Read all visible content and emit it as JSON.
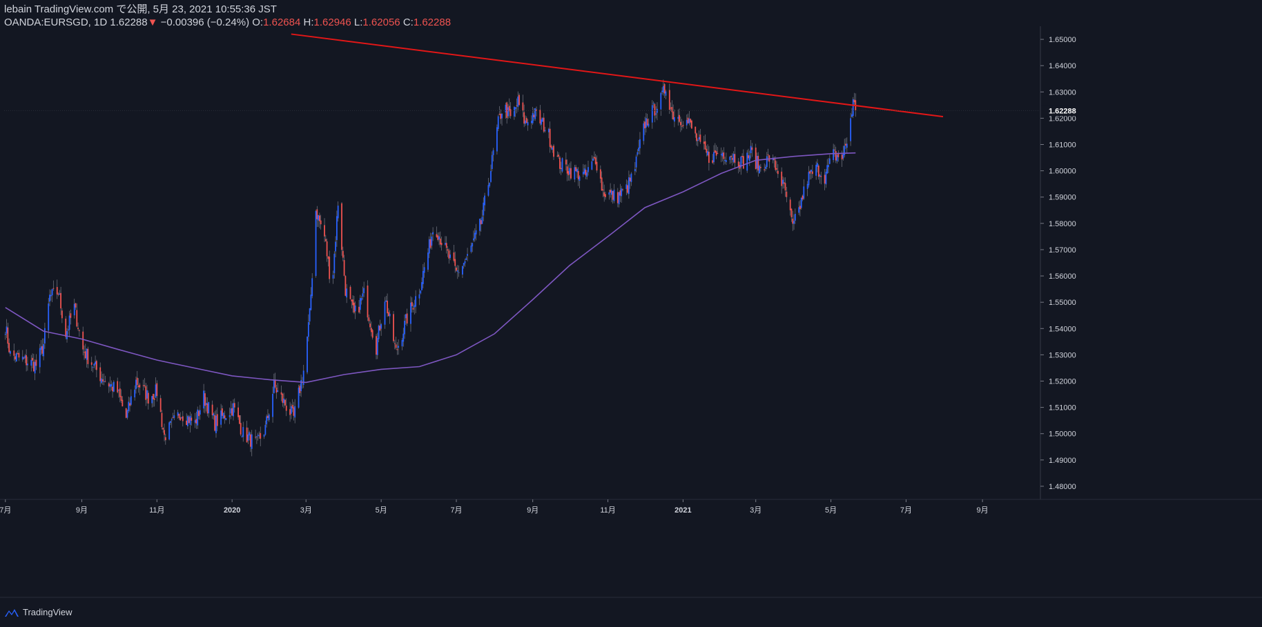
{
  "header": {
    "line1": "lebain TradingView.com で公開, 5月 23, 2021 10:55:36 JST",
    "symbol": "OANDA:EURSGD, 1D",
    "last": "1.62288",
    "down_arrow": "▼",
    "change": "−0.00396 (−0.24%)",
    "o_label": "O:",
    "o_value": "1.62684",
    "h_label": "H:",
    "h_value": "1.62946",
    "l_label": "L:",
    "l_value": "1.62056",
    "c_label": "C:",
    "c_value": "1.62288"
  },
  "footer": {
    "brand": "TradingView",
    "icon": "tradingview-logo-icon"
  },
  "colors": {
    "background": "#131722",
    "up": "#2962ff",
    "down": "#ef5350",
    "ma": "#7e57c2",
    "trendline": "#e31717",
    "text": "#d1d4dc"
  },
  "chart_data": {
    "type": "candlestick",
    "ylim": [
      1.475,
      1.655
    ],
    "y_ticks": [
      "1.65000",
      "1.64000",
      "1.63000",
      "1.62000",
      "1.61000",
      "1.60000",
      "1.59000",
      "1.58000",
      "1.57000",
      "1.56000",
      "1.55000",
      "1.54000",
      "1.53000",
      "1.52000",
      "1.51000",
      "1.50000",
      "1.49000",
      "1.48000"
    ],
    "x_ticks": [
      "7月",
      "9月",
      "11月",
      "2020",
      "3月",
      "5月",
      "7月",
      "9月",
      "11月",
      "2021",
      "3月",
      "5月",
      "7月",
      "9月"
    ],
    "last_price_label": "1.62288",
    "close_path": [
      [
        "2019-07-01",
        1.541
      ],
      [
        "2019-07-05",
        1.53
      ],
      [
        "2019-07-16",
        1.528
      ],
      [
        "2019-07-26",
        1.526
      ],
      [
        "2019-08-01",
        1.534
      ],
      [
        "2019-08-06",
        1.552
      ],
      [
        "2019-08-13",
        1.554
      ],
      [
        "2019-08-19",
        1.538
      ],
      [
        "2019-08-26",
        1.548
      ],
      [
        "2019-09-02",
        1.532
      ],
      [
        "2019-09-16",
        1.522
      ],
      [
        "2019-09-30",
        1.516
      ],
      [
        "2019-10-07",
        1.506
      ],
      [
        "2019-10-15",
        1.52
      ],
      [
        "2019-10-25",
        1.514
      ],
      [
        "2019-11-01",
        1.516
      ],
      [
        "2019-11-07",
        1.499
      ],
      [
        "2019-11-20",
        1.508
      ],
      [
        "2019-12-02",
        1.504
      ],
      [
        "2019-12-09",
        1.514
      ],
      [
        "2019-12-18",
        1.504
      ],
      [
        "2020-01-02",
        1.51
      ],
      [
        "2020-01-10",
        1.5
      ],
      [
        "2020-01-21",
        1.496
      ],
      [
        "2020-01-28",
        1.502
      ],
      [
        "2020-02-04",
        1.518
      ],
      [
        "2020-02-12",
        1.512
      ],
      [
        "2020-02-20",
        1.506
      ],
      [
        "2020-02-28",
        1.524
      ],
      [
        "2020-03-04",
        1.545
      ],
      [
        "2020-03-09",
        1.585
      ],
      [
        "2020-03-16",
        1.575
      ],
      [
        "2020-03-22",
        1.555
      ],
      [
        "2020-03-27",
        1.588
      ],
      [
        "2020-04-02",
        1.555
      ],
      [
        "2020-04-09",
        1.545
      ],
      [
        "2020-04-17",
        1.553
      ],
      [
        "2020-04-27",
        1.533
      ],
      [
        "2020-05-04",
        1.552
      ],
      [
        "2020-05-13",
        1.531
      ],
      [
        "2020-05-22",
        1.544
      ],
      [
        "2020-06-01",
        1.555
      ],
      [
        "2020-06-09",
        1.571
      ],
      [
        "2020-06-13",
        1.58
      ],
      [
        "2020-06-22",
        1.57
      ],
      [
        "2020-07-01",
        1.561
      ],
      [
        "2020-07-10",
        1.567
      ],
      [
        "2020-07-21",
        1.58
      ],
      [
        "2020-07-28",
        1.598
      ],
      [
        "2020-08-04",
        1.618
      ],
      [
        "2020-08-08",
        1.625
      ],
      [
        "2020-08-14",
        1.62
      ],
      [
        "2020-08-20",
        1.626
      ],
      [
        "2020-08-26",
        1.618
      ],
      [
        "2020-09-02",
        1.622
      ],
      [
        "2020-09-12",
        1.616
      ],
      [
        "2020-09-22",
        1.603
      ],
      [
        "2020-10-02",
        1.6
      ],
      [
        "2020-10-14",
        1.598
      ],
      [
        "2020-10-22",
        1.605
      ],
      [
        "2020-10-28",
        1.592
      ],
      [
        "2020-11-08",
        1.59
      ],
      [
        "2020-11-16",
        1.593
      ],
      [
        "2020-11-22",
        1.599
      ],
      [
        "2020-12-01",
        1.618
      ],
      [
        "2020-12-08",
        1.623
      ],
      [
        "2020-12-14",
        1.627
      ],
      [
        "2020-12-18",
        1.632
      ],
      [
        "2020-12-23",
        1.622
      ],
      [
        "2021-01-06",
        1.618
      ],
      [
        "2021-01-14",
        1.61
      ],
      [
        "2021-01-22",
        1.605
      ],
      [
        "2021-02-01",
        1.607
      ],
      [
        "2021-02-10",
        1.606
      ],
      [
        "2021-02-18",
        1.603
      ],
      [
        "2021-02-25",
        1.607
      ],
      [
        "2021-03-04",
        1.601
      ],
      [
        "2021-03-12",
        1.605
      ],
      [
        "2021-03-19",
        1.6
      ],
      [
        "2021-03-26",
        1.59
      ],
      [
        "2021-03-31",
        1.578
      ],
      [
        "2021-04-05",
        1.585
      ],
      [
        "2021-04-12",
        1.597
      ],
      [
        "2021-04-20",
        1.601
      ],
      [
        "2021-04-26",
        1.598
      ],
      [
        "2021-05-03",
        1.606
      ],
      [
        "2021-05-10",
        1.605
      ],
      [
        "2021-05-14",
        1.611
      ],
      [
        "2021-05-17",
        1.62
      ],
      [
        "2021-05-19",
        1.626
      ],
      [
        "2021-05-21",
        1.6229
      ]
    ],
    "moving_average": [
      [
        "2019-07-01",
        1.548
      ],
      [
        "2019-08-01",
        1.539
      ],
      [
        "2019-09-01",
        1.536
      ],
      [
        "2019-10-01",
        1.532
      ],
      [
        "2019-11-01",
        1.528
      ],
      [
        "2019-12-01",
        1.525
      ],
      [
        "2020-01-01",
        1.522
      ],
      [
        "2020-02-01",
        1.5205
      ],
      [
        "2020-03-01",
        1.5195
      ],
      [
        "2020-04-01",
        1.5225
      ],
      [
        "2020-05-01",
        1.5245
      ],
      [
        "2020-06-01",
        1.5255
      ],
      [
        "2020-07-01",
        1.53
      ],
      [
        "2020-08-01",
        1.538
      ],
      [
        "2020-09-01",
        1.551
      ],
      [
        "2020-10-01",
        1.564
      ],
      [
        "2020-11-01",
        1.575
      ],
      [
        "2020-12-01",
        1.586
      ],
      [
        "2021-01-01",
        1.592
      ],
      [
        "2021-02-01",
        1.599
      ],
      [
        "2021-03-01",
        1.604
      ],
      [
        "2021-04-01",
        1.6055
      ],
      [
        "2021-05-01",
        1.6065
      ],
      [
        "2021-05-21",
        1.6068
      ]
    ],
    "trendline": [
      [
        "2020-02-18",
        1.652
      ],
      [
        "2021-07-31",
        1.6206
      ]
    ]
  }
}
